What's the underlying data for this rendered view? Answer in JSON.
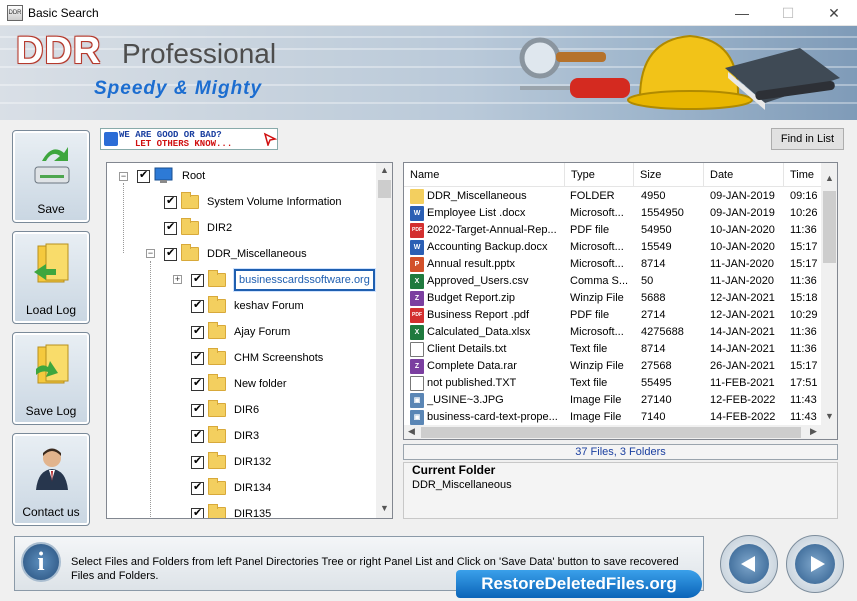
{
  "window": {
    "title": "Basic Search",
    "minimize": "—",
    "maximize": "☐",
    "close": "✕"
  },
  "banner": {
    "logo_brand": "DDR",
    "logo_product": "Professional",
    "tagline": "Speedy & Mighty"
  },
  "sidebar": [
    {
      "label": "Save",
      "icon": "save-drive-icon"
    },
    {
      "label": "Load Log",
      "icon": "load-log-icon"
    },
    {
      "label": "Save Log",
      "icon": "save-log-icon"
    },
    {
      "label": "Contact us",
      "icon": "contact-person-icon"
    }
  ],
  "feedback_banner": {
    "line1": "WE ARE GOOD OR BAD?",
    "line2": "LET OTHERS KNOW..."
  },
  "find_button": "Find in List",
  "tree": {
    "root": "Root",
    "items": [
      {
        "label": "System Volume Information",
        "level": 1
      },
      {
        "label": "DIR2",
        "level": 1
      },
      {
        "label": "DDR_Miscellaneous",
        "level": 1
      },
      {
        "label": "businesscardssoftware.org",
        "level": 2,
        "selected": true
      },
      {
        "label": "keshav Forum",
        "level": 2
      },
      {
        "label": "Ajay Forum",
        "level": 2
      },
      {
        "label": "CHM Screenshots",
        "level": 2
      },
      {
        "label": "New folder",
        "level": 2
      },
      {
        "label": "DIR6",
        "level": 2
      },
      {
        "label": "DIR3",
        "level": 2
      },
      {
        "label": "DIR132",
        "level": 2
      },
      {
        "label": "DIR134",
        "level": 2
      },
      {
        "label": "DIR135",
        "level": 2
      }
    ]
  },
  "list": {
    "columns": [
      "Name",
      "Type",
      "Size",
      "Date",
      "Time"
    ],
    "rows": [
      {
        "name": "DDR_Miscellaneous",
        "type": "FOLDER",
        "size": "4950",
        "date": "09-JAN-2019",
        "time": "09:16",
        "icon": "folder-icon"
      },
      {
        "name": "Employee List .docx",
        "type": "Microsoft...",
        "size": "1554950",
        "date": "09-JAN-2019",
        "time": "10:26",
        "icon": "word-icon"
      },
      {
        "name": "2022-Target-Annual-Rep...",
        "type": "PDF file",
        "size": "54950",
        "date": "10-JAN-2020",
        "time": "11:36",
        "icon": "pdf-icon"
      },
      {
        "name": "Accounting Backup.docx",
        "type": "Microsoft...",
        "size": "15549",
        "date": "10-JAN-2020",
        "time": "15:17",
        "icon": "word-icon"
      },
      {
        "name": "Annual result.pptx",
        "type": "Microsoft...",
        "size": "8714",
        "date": "11-JAN-2020",
        "time": "15:17",
        "icon": "powerpoint-icon"
      },
      {
        "name": "Approved_Users.csv",
        "type": "Comma S...",
        "size": "50",
        "date": "11-JAN-2020",
        "time": "11:36",
        "icon": "excel-icon"
      },
      {
        "name": "Budget Report.zip",
        "type": "Winzip File",
        "size": "5688",
        "date": "12-JAN-2021",
        "time": "15:18",
        "icon": "archive-icon"
      },
      {
        "name": "Business Report .pdf",
        "type": "PDF file",
        "size": "2714",
        "date": "12-JAN-2021",
        "time": "10:29",
        "icon": "pdf-icon"
      },
      {
        "name": "Calculated_Data.xlsx",
        "type": "Microsoft...",
        "size": "4275688",
        "date": "14-JAN-2021",
        "time": "11:36",
        "icon": "excel-icon"
      },
      {
        "name": "Client Details.txt",
        "type": "Text file",
        "size": "8714",
        "date": "14-JAN-2021",
        "time": "11:36",
        "icon": "text-file-icon"
      },
      {
        "name": "Complete Data.rar",
        "type": "Winzip File",
        "size": "27568",
        "date": "26-JAN-2021",
        "time": "15:17",
        "icon": "archive-icon"
      },
      {
        "name": "not published.TXT",
        "type": "Text file",
        "size": "55495",
        "date": "11-FEB-2021",
        "time": "17:51",
        "icon": "text-file-icon"
      },
      {
        "name": "_USINE~3.JPG",
        "type": "Image File",
        "size": "27140",
        "date": "12-FEB-2022",
        "time": "11:43",
        "icon": "image-icon"
      },
      {
        "name": "business-card-text-prope...",
        "type": "Image File",
        "size": "7140",
        "date": "14-FEB-2022",
        "time": "11:43",
        "icon": "image-icon"
      }
    ]
  },
  "status": "37 Files, 3 Folders",
  "current_folder": {
    "title": "Current Folder",
    "value": "DDR_Miscellaneous"
  },
  "bottom": {
    "message": "Select Files and Folders from left Panel Directories Tree or right Panel List and Click on 'Save Data' button to save recovered Files and Folders.",
    "site": "RestoreDeletedFiles.org"
  },
  "colors": {
    "accent": "#1f5fb0",
    "status_text": "#1a3fa0",
    "badge": "#0b64b8"
  }
}
